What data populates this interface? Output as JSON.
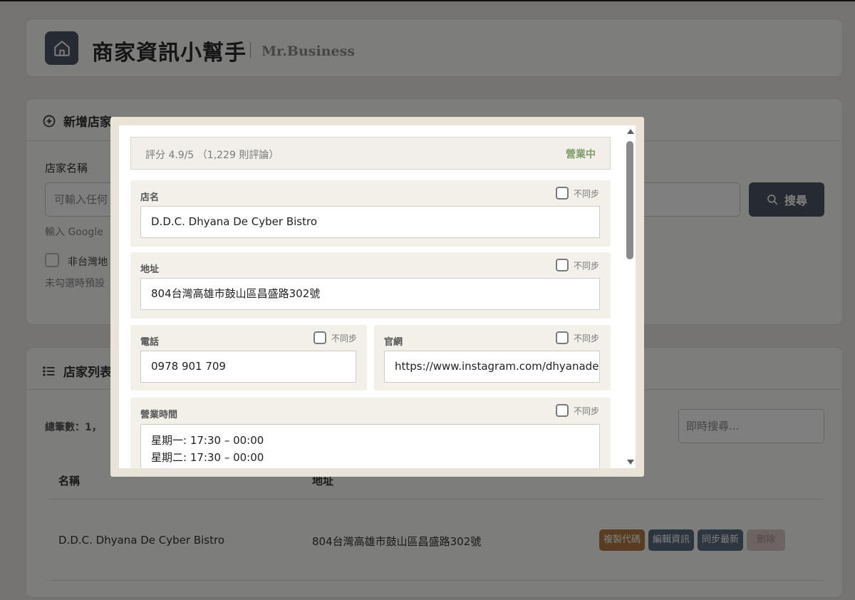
{
  "header": {
    "home_icon": "home-icon",
    "title": "商家資訊小幫手",
    "subtitle": "Mr.Business"
  },
  "add_store": {
    "section_title": "新增店家",
    "section_icon": "plus-circle-icon",
    "store_name_label": "店家名稱",
    "store_name_placeholder": "可輸入任何",
    "search_label": "搜尋",
    "search_icon": "search-icon",
    "hint": "輸入 Google",
    "non_taiwan_label": "非台灣地",
    "non_taiwan_hint": "未勾選時預設"
  },
  "store_list": {
    "section_title": "店家列表",
    "section_icon": "list-icon",
    "total_count": "總筆數：1，",
    "live_search_placeholder": "即時搜尋...",
    "headers": [
      "名稱",
      "地址"
    ],
    "rows": [
      {
        "name": "D.D.C. Dhyana De Cyber Bistro",
        "address": "804台灣高雄市鼓山區昌盛路302號",
        "actions": [
          "複製代碼",
          "編輯資訊",
          "同步最新",
          "刪除"
        ]
      }
    ],
    "action_colors": [
      "#b07a45",
      "#5a6b7c",
      "#5d6d7e",
      "#d8c9c6"
    ]
  },
  "modal": {
    "rating": "評分 4.9/5 （1,229 則評論）",
    "status": "營業中",
    "status_color": "#7fa06b",
    "sync_label": "不同步",
    "fields": {
      "name_label": "店名",
      "name_value": "D.D.C. Dhyana De Cyber Bistro",
      "address_label": "地址",
      "address_value": "804台灣高雄市鼓山區昌盛路302號",
      "phone_label": "電話",
      "phone_value": "0978 901 709",
      "website_label": "官網",
      "website_value": "https://www.instagram.com/dhyanade",
      "hours_label": "營業時間",
      "hours": [
        "星期一: 17:30 – 00:00",
        "星期二: 17:30 – 00:00"
      ]
    }
  }
}
